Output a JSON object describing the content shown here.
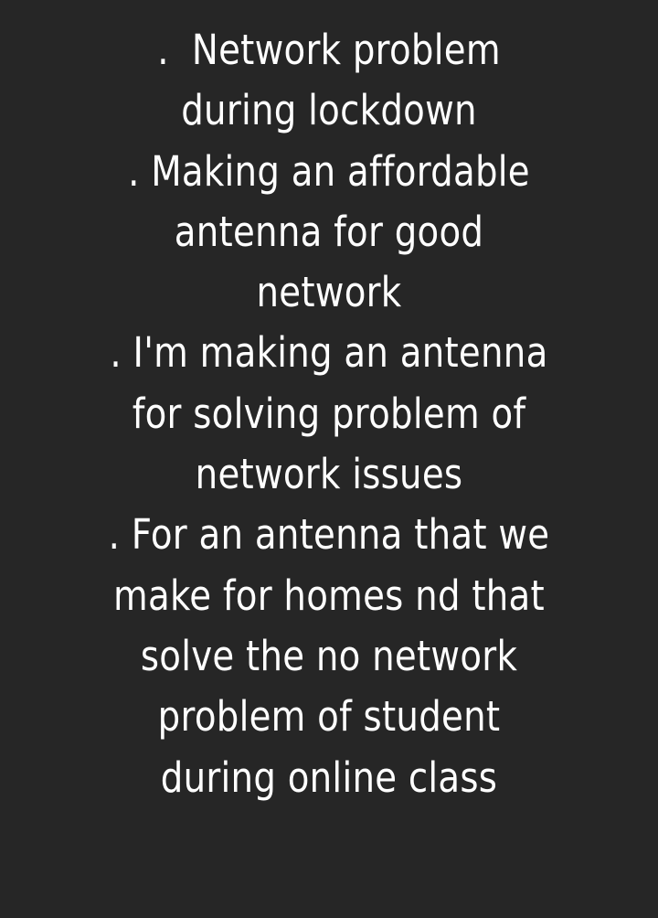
{
  "background_color": "#262626",
  "text_color": "#ffffff",
  "lines": [
    ".  Network problem",
    "during lockdown",
    ". Making an affordable",
    "antenna for good",
    "network",
    ". I'm making an antenna",
    "for solving problem of",
    "network issues",
    ". For an antenna that we",
    "make for homes nd that",
    "solve the no network",
    "problem of student",
    "during online class"
  ]
}
